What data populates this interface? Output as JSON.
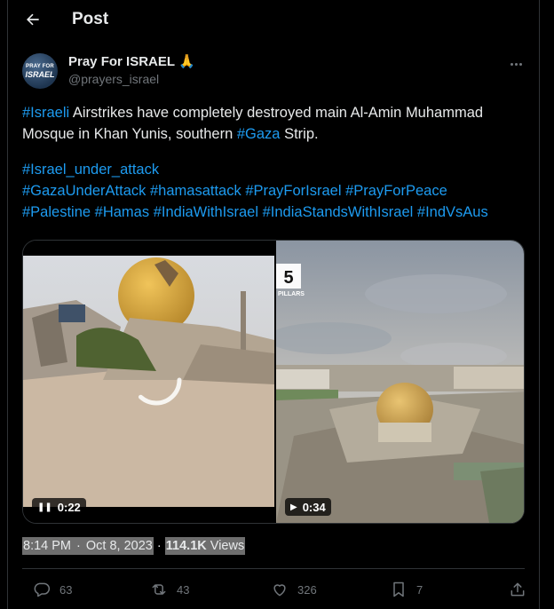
{
  "header": {
    "title": "Post",
    "back_icon": "arrow-left-icon"
  },
  "author": {
    "name": "Pray For ISRAEL",
    "emoji": "🙏",
    "handle": "@prayers_israel",
    "avatar_line1": "PRAY FOR",
    "avatar_line2": "ISRAEL"
  },
  "post": {
    "line1_tag": "#Israeli",
    "line1_text": " Airstrikes have completely destroyed main Al-Amin Muhammad",
    "line2_text": "Mosque in Khan Yunis, southern ",
    "line2_tag": "#Gaza",
    "line2_end": " Strip.",
    "hashtags_row1": [
      "#Israel_under_attack"
    ],
    "hashtags_row2": [
      "#GazaUnderAttack",
      "#hamasattack",
      "#PrayForIsrael",
      "#PrayForPeace"
    ],
    "hashtags_row3": [
      "#Palestine",
      "#Hamas",
      "#IndiaWithIsrael",
      "#IndiaStandsWithIsrael",
      "#IndVsAus"
    ]
  },
  "media": {
    "video1": {
      "duration": "0:22",
      "state_icon": "pause-icon",
      "loading": true
    },
    "video2": {
      "duration": "0:34",
      "state_icon": "play-icon",
      "overlay_number": "5",
      "overlay_text": "PILLARS"
    }
  },
  "meta": {
    "time": "8:14 PM",
    "separator": "·",
    "date": "Oct 8, 2023",
    "views_count": "114.1K",
    "views_label": "Views"
  },
  "actions": {
    "replies": "63",
    "reposts": "43",
    "likes": "326",
    "bookmarks": "7"
  }
}
